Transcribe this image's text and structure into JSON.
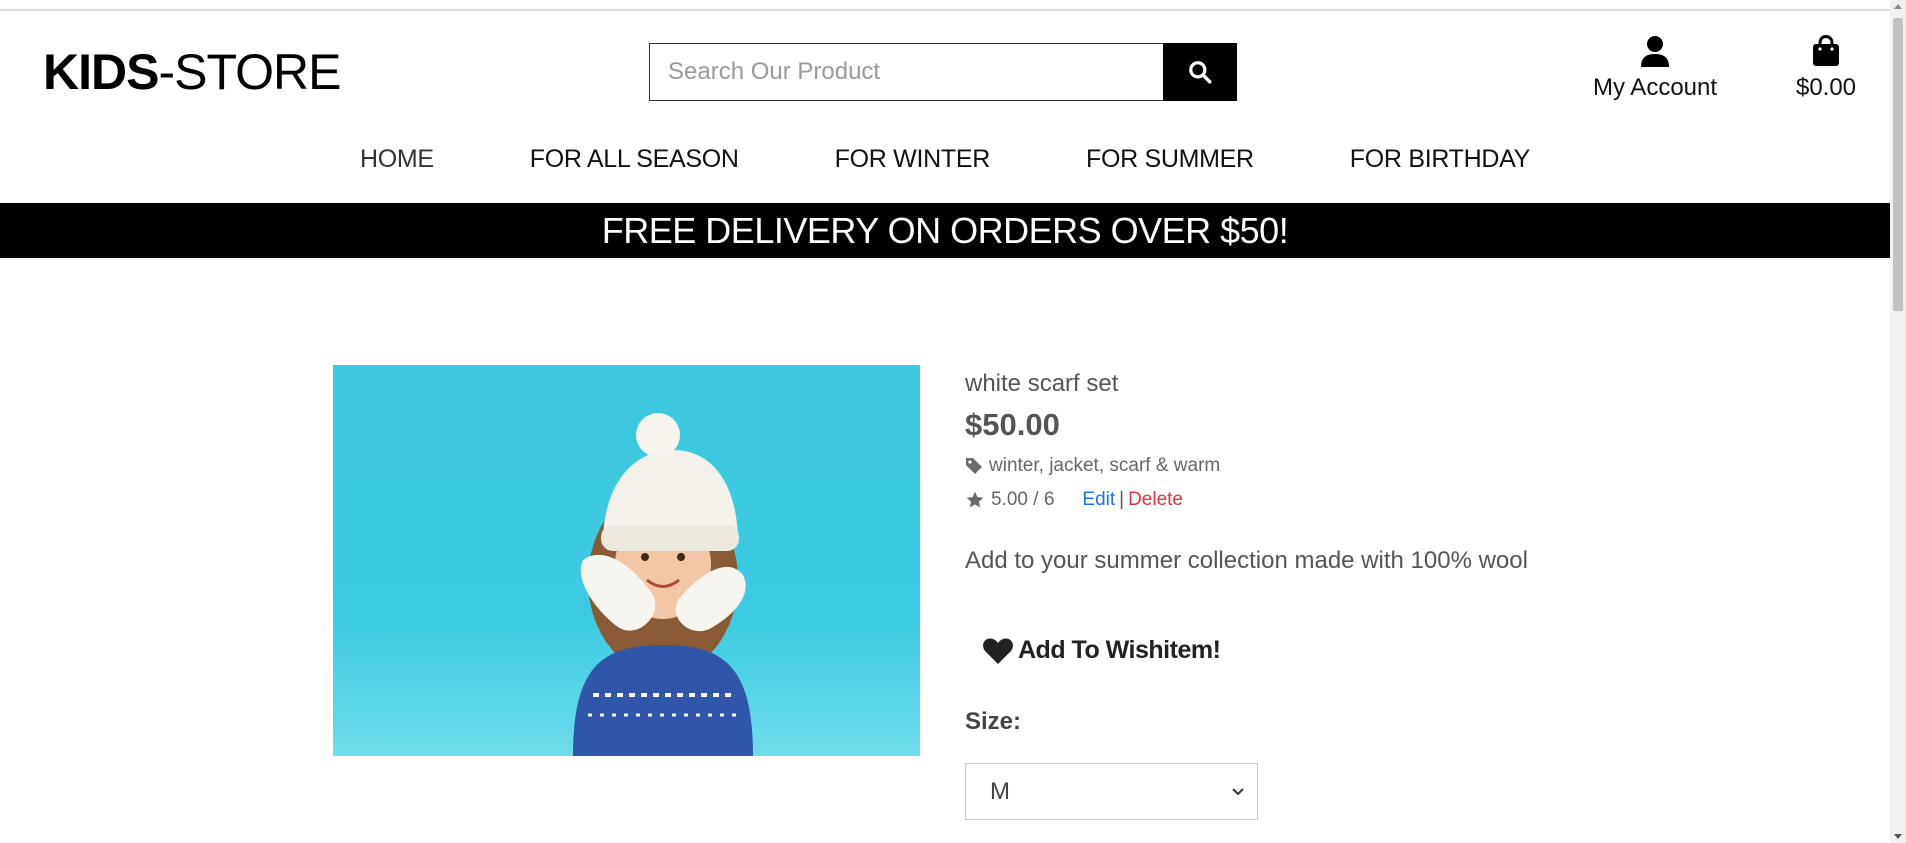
{
  "header": {
    "logo_bold": "KIDS",
    "logo_light": "-STORE",
    "search_placeholder": "Search Our Product",
    "account_label": "My Account",
    "cart_total": "$0.00"
  },
  "nav": {
    "items": [
      {
        "label": "HOME"
      },
      {
        "label": "FOR ALL SEASON"
      },
      {
        "label": "FOR WINTER"
      },
      {
        "label": "FOR SUMMER"
      },
      {
        "label": "FOR BIRTHDAY"
      }
    ]
  },
  "banner": {
    "text": "FREE DELIVERY ON ORDERS OVER $50!"
  },
  "product": {
    "name": "white scarf set",
    "price": "$50.00",
    "tags": "winter, jacket, scarf & warm",
    "rating": "5.00 / 6",
    "edit_label": "Edit",
    "separator": "|",
    "delete_label": "Delete",
    "description": "Add to your summer collection made with 100% wool",
    "wishlist_label": "Add To Wishitem!",
    "size_label": "Size:",
    "size_value": "M"
  },
  "colors": {
    "banner_bg": "#000000",
    "edit_link": "#1a73e8",
    "delete_link": "#dc3545",
    "image_bg": "#3ecbe0"
  },
  "icons": {
    "search": "search-icon",
    "account": "user-icon",
    "cart": "shopping-bag-icon",
    "tag": "tag-icon",
    "rating": "star-icon",
    "wishlist": "heart-icon",
    "select": "chevron-down-icon"
  }
}
